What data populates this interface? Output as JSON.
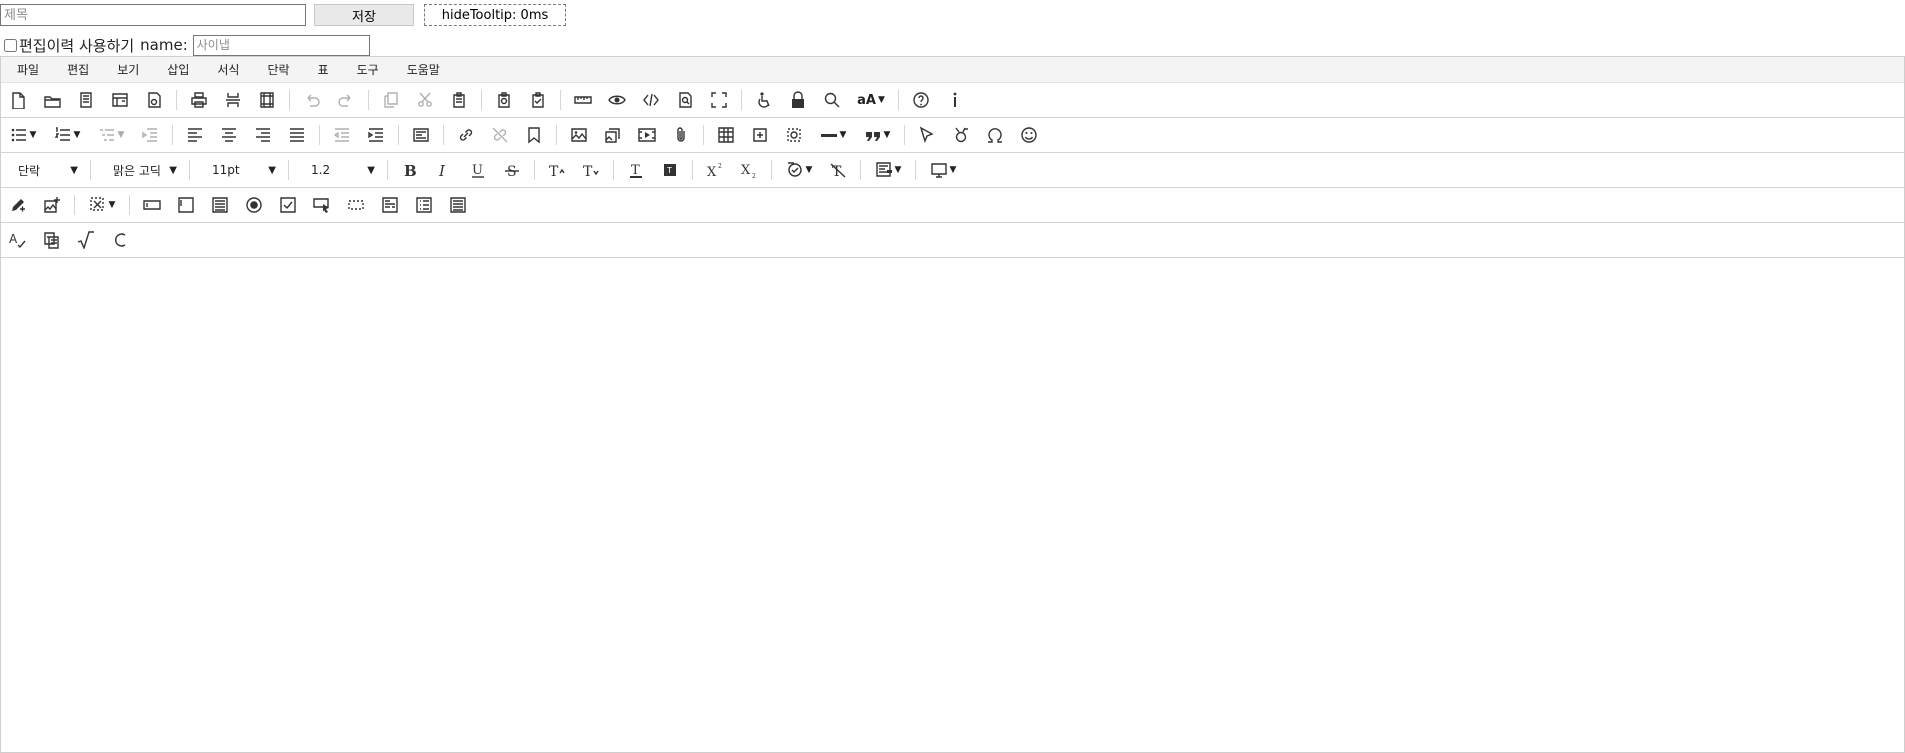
{
  "title_field": {
    "placeholder": "제목"
  },
  "save_button": {
    "label": "저장"
  },
  "tooltip_button": {
    "label": "hideTooltip: 0ms"
  },
  "history": {
    "checkbox_label": "편집이력 사용하기",
    "name_label": "name:",
    "name_placeholder": "사이냅"
  },
  "menu": [
    "파일",
    "편집",
    "보기",
    "삽입",
    "서식",
    "단락",
    "표",
    "도구",
    "도움말"
  ],
  "format": {
    "paragraph_style": "단락",
    "font_family": "맑은 고딕",
    "font_size": "11pt",
    "line_height": "1.2"
  },
  "toolbar_icons": {
    "row1": [
      "new-document-icon",
      "open-folder-icon",
      "template-icon",
      "layout-icon",
      "document-settings-icon",
      "print-icon",
      "page-break-icon",
      "page-setup-icon",
      "undo-icon",
      "redo-icon",
      "copy-icon",
      "cut-icon",
      "paste-icon",
      "paste-special-icon",
      "paste-options-icon",
      "ruler-icon",
      "preview-icon",
      "source-code-icon",
      "find-document-icon",
      "fullscreen-icon",
      "accessibility-icon",
      "lock-icon",
      "search-icon",
      "font-size-icon",
      "help-icon",
      "info-icon"
    ],
    "row2": [
      "bulleted-list-icon",
      "numbered-list-icon",
      "multilevel-list-icon",
      "outdent-list-icon",
      "align-left-icon",
      "align-center-icon",
      "align-right-icon",
      "justify-icon",
      "decrease-indent-icon",
      "increase-indent-icon",
      "paragraph-format-icon",
      "link-icon",
      "unlink-icon",
      "bookmark-icon",
      "image-icon",
      "image-gallery-icon",
      "video-icon",
      "attachment-icon",
      "table-icon",
      "insert-box-icon",
      "insert-frame-icon",
      "horizontal-rule-icon",
      "quote-icon",
      "cursor-icon",
      "special-pointer-icon",
      "omega-icon",
      "emoji-icon"
    ],
    "row3": [
      "bold-icon",
      "italic-icon",
      "underline-icon",
      "strikethrough-icon",
      "text-grow-icon",
      "text-shrink-icon",
      "text-color-icon",
      "highlight-icon",
      "superscript-icon",
      "subscript-icon",
      "format-painter-icon",
      "clear-format-icon",
      "style-icon",
      "display-icon"
    ],
    "row4": [
      "edit-pen-icon",
      "add-image-icon",
      "select-area-icon",
      "input-field-icon",
      "text-field-icon",
      "textarea-icon",
      "radio-icon",
      "checkbox-icon",
      "button-icon",
      "dotted-box-icon",
      "form-field-icon",
      "list-form-icon",
      "form-options-icon"
    ],
    "row5": [
      "spellcheck-icon",
      "translate-icon",
      "formula-icon",
      "shape-icon"
    ]
  }
}
